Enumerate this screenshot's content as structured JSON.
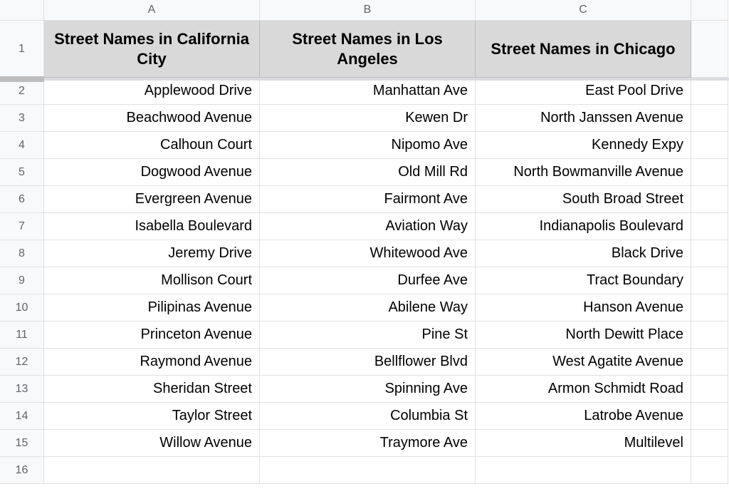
{
  "columns": [
    "A",
    "B",
    "C",
    ""
  ],
  "row_numbers": [
    "1",
    "2",
    "3",
    "4",
    "5",
    "6",
    "7",
    "8",
    "9",
    "10",
    "11",
    "12",
    "13",
    "14",
    "15",
    "16"
  ],
  "headers": {
    "A": "Street Names in California City",
    "B": "Street Names in Los Angeles",
    "C": "Street Names in Chicago"
  },
  "rows": [
    {
      "A": "Applewood Drive",
      "B": "Manhattan Ave",
      "C": "East Pool Drive"
    },
    {
      "A": "Beachwood Avenue",
      "B": "Kewen Dr",
      "C": "North Janssen Avenue"
    },
    {
      "A": "Calhoun Court",
      "B": "Nipomo Ave",
      "C": "Kennedy Expy"
    },
    {
      "A": "Dogwood Avenue",
      "B": "Old Mill Rd",
      "C": "North Bowmanville Avenue"
    },
    {
      "A": "Evergreen Avenue",
      "B": "Fairmont Ave",
      "C": "South Broad Street"
    },
    {
      "A": "Isabella Boulevard",
      "B": "Aviation Way",
      "C": "Indianapolis Boulevard"
    },
    {
      "A": "Jeremy Drive",
      "B": "Whitewood Ave",
      "C": "Black Drive"
    },
    {
      "A": "Mollison Court",
      "B": "Durfee Ave",
      "C": "Tract Boundary"
    },
    {
      "A": "Pilipinas Avenue",
      "B": "Abilene Way",
      "C": "Hanson Avenue"
    },
    {
      "A": "Princeton Avenue",
      "B": "Pine St",
      "C": "North Dewitt Place"
    },
    {
      "A": "Raymond Avenue",
      "B": "Bellflower Blvd",
      "C": "West Agatite Avenue"
    },
    {
      "A": "Sheridan Street",
      "B": "Spinning Ave",
      "C": "Armon Schmidt Road"
    },
    {
      "A": "Taylor Street",
      "B": "Columbia St",
      "C": "Latrobe Avenue"
    },
    {
      "A": "Willow Avenue",
      "B": "Traymore Ave",
      "C": "Multilevel"
    },
    {
      "A": "",
      "B": "",
      "C": ""
    }
  ]
}
